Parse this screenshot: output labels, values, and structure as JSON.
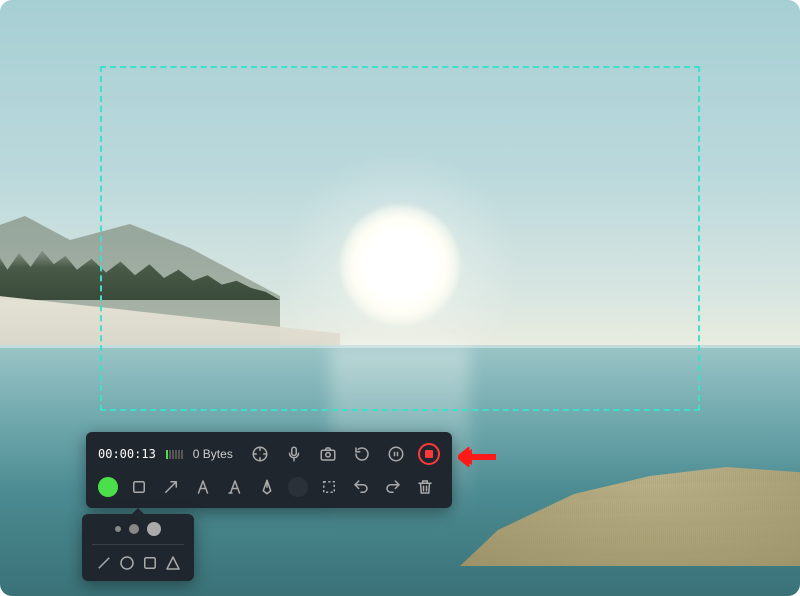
{
  "recorder": {
    "timer": "00:00:13",
    "file_size": "0 Bytes",
    "audio_bars_active": 1,
    "audio_bars_total": 6,
    "controls": {
      "cursor": "cursor-highlight",
      "mic": "microphone",
      "camera": "screenshot",
      "reset": "reset",
      "pause": "pause",
      "stop": "stop"
    },
    "annotate": {
      "active_color": "#4be04b",
      "tools": [
        "rectangle",
        "arrow",
        "text",
        "highlighter",
        "pen",
        "line-color",
        "crop",
        "undo",
        "redo",
        "delete"
      ]
    }
  },
  "callout": {
    "color": "#ff1a1a"
  },
  "shape_panel": {
    "sizes": [
      "small",
      "medium",
      "large"
    ],
    "shapes": [
      "line",
      "circle",
      "square",
      "triangle"
    ]
  }
}
